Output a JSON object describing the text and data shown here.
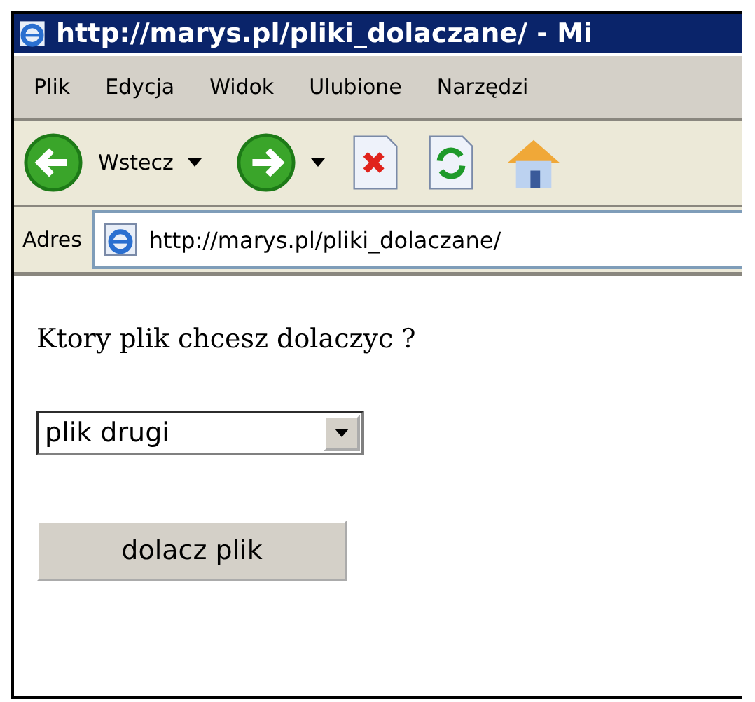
{
  "window": {
    "title": "http://marys.pl/pliki_dolaczane/ - Mi"
  },
  "menu": [
    "Plik",
    "Edycja",
    "Widok",
    "Ulubione",
    "Narzędzi"
  ],
  "toolbar": {
    "back_label": "Wstecz"
  },
  "address": {
    "label": "Adres",
    "value": "http://marys.pl/pliki_dolaczane/"
  },
  "page": {
    "question": "Ktory plik chcesz dolaczyc ?",
    "select_value": "plik drugi",
    "button": "dolacz plik"
  }
}
